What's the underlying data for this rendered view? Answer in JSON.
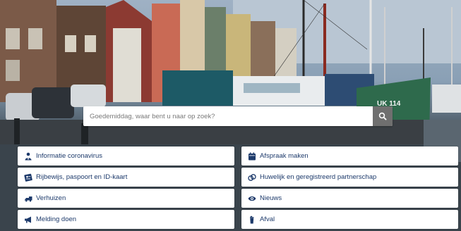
{
  "search": {
    "placeholder": "Goedemiddag, waar bent u naar op zoek?",
    "button_icon": "search-icon"
  },
  "tiles": [
    {
      "label": "Informatie coronavirus",
      "icon": "person-info-icon"
    },
    {
      "label": "Afspraak maken",
      "icon": "calendar-icon"
    },
    {
      "label": "Rijbewijs, paspoort en ID-kaart",
      "icon": "id-card-icon"
    },
    {
      "label": "Huwelijk en geregistreerd partnerschap",
      "icon": "rings-icon"
    },
    {
      "label": "Verhuizen",
      "icon": "moving-truck-icon"
    },
    {
      "label": "Nieuws",
      "icon": "eye-icon"
    },
    {
      "label": "Melding doen",
      "icon": "megaphone-icon"
    },
    {
      "label": "Afval",
      "icon": "waste-bin-icon"
    }
  ],
  "boat_label": "UK 114",
  "colors": {
    "tile_text": "#1d3a6b",
    "icon": "#1d3a6b",
    "search_button": "#6f6f6f"
  }
}
